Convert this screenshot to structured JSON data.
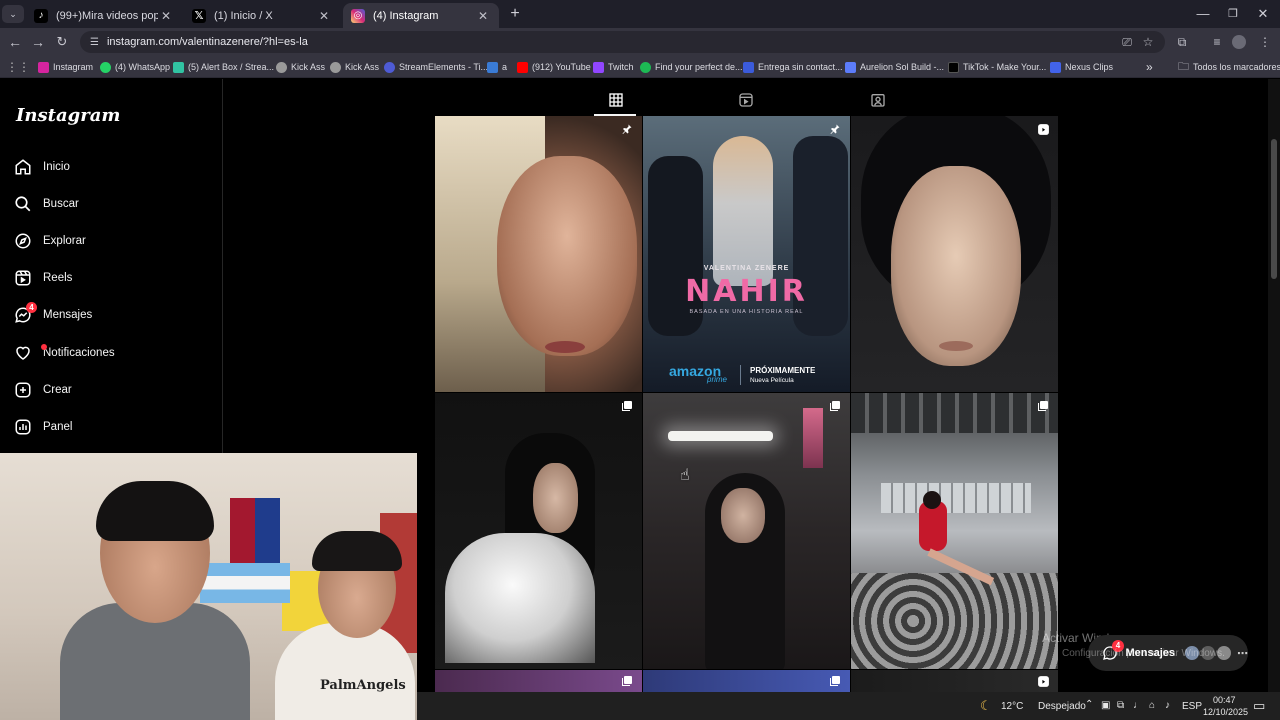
{
  "browser": {
    "tabs": [
      {
        "title": "(99+)Mira videos populares sob",
        "icon": "tiktok-icon"
      },
      {
        "title": "(1) Inicio / X",
        "icon": "x-icon"
      },
      {
        "title": "(4) Instagram",
        "icon": "instagram-icon",
        "active": true
      }
    ],
    "url": "instagram.com/valentinazenere/?hl=es-la",
    "bookmarks": [
      {
        "label": "Instagram",
        "color": "#d6249f"
      },
      {
        "label": "(4) WhatsApp",
        "color": "#25d366"
      },
      {
        "label": "(5) Alert Box / Strea...",
        "color": "#31c3a2"
      },
      {
        "label": "Kick Ass",
        "color": "#9a9a9a"
      },
      {
        "label": "Kick Ass",
        "color": "#9a9a9a"
      },
      {
        "label": "StreamElements - Ti...",
        "color": "#4e5bd5"
      },
      {
        "label": "a",
        "color": "#3a7bd5"
      },
      {
        "label": "(912) YouTube",
        "color": "#ff0000"
      },
      {
        "label": "Twitch",
        "color": "#9146ff"
      },
      {
        "label": "Find your perfect de...",
        "color": "#1db954"
      },
      {
        "label": "Entrega sin contact...",
        "color": "#3b5bdb"
      },
      {
        "label": "Aurelion Sol Build -...",
        "color": "#5c7cfa"
      },
      {
        "label": "TikTok - Make Your...",
        "color": "#000000"
      },
      {
        "label": "Nexus Clips",
        "color": "#4263eb"
      }
    ],
    "more_bookmarks": "»",
    "all_bookmarks": "Todos los marcadores"
  },
  "instagram": {
    "logo": "Instagram",
    "nav": [
      {
        "label": "Inicio",
        "icon": "home-icon"
      },
      {
        "label": "Buscar",
        "icon": "search-icon"
      },
      {
        "label": "Explorar",
        "icon": "compass-icon"
      },
      {
        "label": "Reels",
        "icon": "reels-icon"
      },
      {
        "label": "Mensajes",
        "icon": "messenger-icon",
        "badge": "4"
      },
      {
        "label": "Notificaciones",
        "icon": "heart-icon",
        "dot": true
      },
      {
        "label": "Crear",
        "icon": "plus-square-icon"
      },
      {
        "label": "Panel",
        "icon": "chart-icon"
      }
    ],
    "profile_tabs": [
      "grid-icon",
      "reels-icon",
      "tagged-icon"
    ],
    "posts": [
      {
        "indicator": "pin-icon"
      },
      {
        "indicator": "pin-icon",
        "poster_name": "VALENTINA ZENERE",
        "poster_title": "NAHIR",
        "poster_tagline": "BASADA EN UNA HISTORIA REAL",
        "brand": "amazon",
        "brand_sub": "prime",
        "promo": "PRÓXIMAMENTE",
        "promo_sub": "Nueva Película"
      },
      {
        "indicator": "reel-icon"
      },
      {
        "indicator": "carousel-icon"
      },
      {
        "indicator": "carousel-icon"
      },
      {
        "indicator": "carousel-icon"
      },
      {
        "indicator": "carousel-icon"
      },
      {
        "indicator": "carousel-icon"
      },
      {
        "indicator": "reel-icon"
      }
    ],
    "messages_pill": {
      "label": "Mensajes",
      "badge": "4"
    }
  },
  "windows": {
    "watermark_title": "Activar Windows",
    "watermark_sub": "Configuración para activar Windows.",
    "weather_temp": "12°C",
    "weather_desc": "Despejado",
    "lang": "ESP",
    "time": "00:47",
    "date": "12/10/2025"
  },
  "colors": {
    "accent": "#ff3040",
    "tab_active": "#35343f"
  }
}
